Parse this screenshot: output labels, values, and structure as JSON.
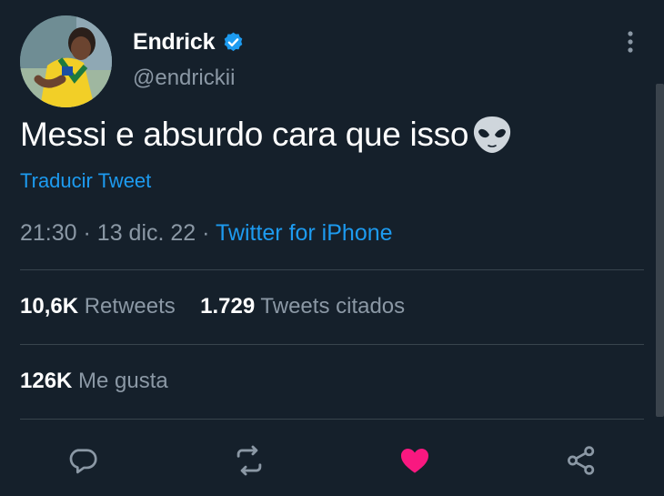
{
  "tweet": {
    "display_name": "Endrick",
    "handle": "@endrickii",
    "text": "Messi e absurdo cara que isso",
    "emoji_icon": "alien-face-icon",
    "translate_label": "Traducir Tweet",
    "time": "21:30",
    "separator": "·",
    "date": "13 dic. 22",
    "source": "Twitter for iPhone"
  },
  "stats": {
    "retweets_count": "10,6K",
    "retweets_label": "Retweets",
    "quotes_count": "1.729",
    "quotes_label": "Tweets citados",
    "likes_count": "126K",
    "likes_label": "Me gusta"
  },
  "actions": [
    {
      "name": "reply",
      "icon": "reply-icon"
    },
    {
      "name": "retweet",
      "icon": "retweet-icon"
    },
    {
      "name": "like",
      "icon": "heart-icon",
      "state": "liked"
    },
    {
      "name": "share",
      "icon": "share-icon"
    }
  ],
  "colors": {
    "background": "#15202b",
    "accent": "#1d9bf0",
    "secondary_text": "#8b98a5",
    "like": "#f91880",
    "divider": "#38444d"
  }
}
